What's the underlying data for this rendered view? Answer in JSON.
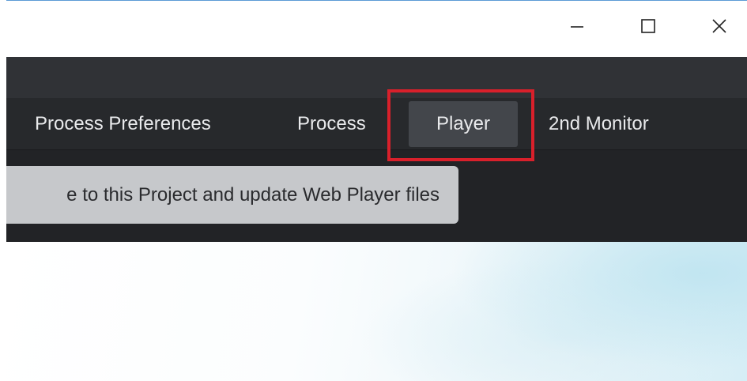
{
  "window": {
    "minimize_glyph": "—",
    "close_glyph": "✕"
  },
  "tabs": [
    {
      "label": "Process Preferences"
    },
    {
      "label": "Process"
    },
    {
      "label": "Player",
      "selected": true
    },
    {
      "label": "2nd Monitor"
    }
  ],
  "toolbar": {
    "save_label": "e to this Project and update Web Player files"
  },
  "colors": {
    "highlight": "#d9202b",
    "tab_bar": "#27292c",
    "selected_tab": "#43464b",
    "button": "#c6c8cb"
  }
}
